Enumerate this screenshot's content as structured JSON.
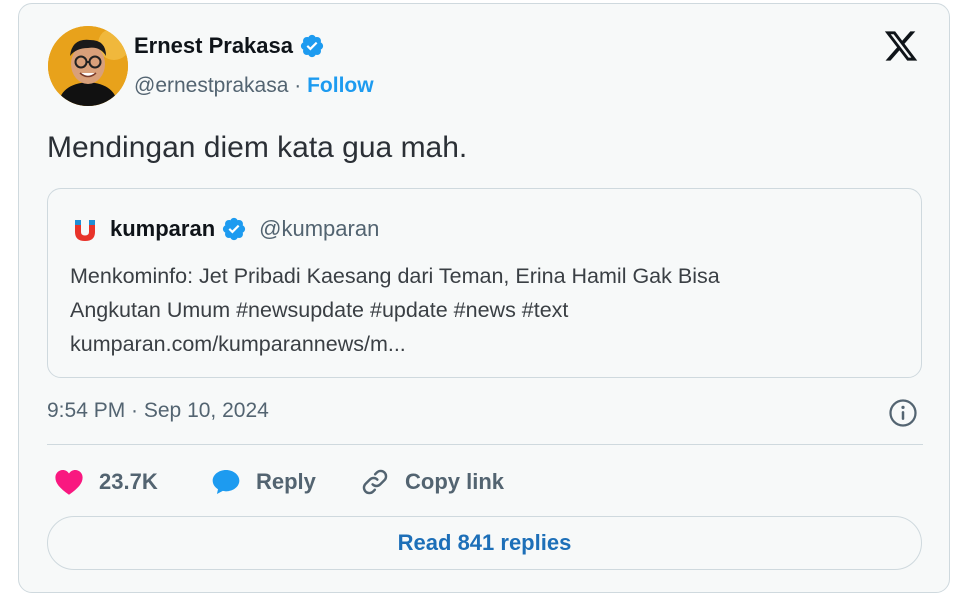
{
  "author": {
    "name": "Ernest Prakasa",
    "handle": "@ernestprakasa",
    "separator": "·",
    "follow_label": "Follow",
    "verified_icon": "verified-badge-icon",
    "avatar_icon": "avatar-photo"
  },
  "platform_icon": "x-logo-icon",
  "tweet": {
    "text": "Mendingan diem kata gua mah."
  },
  "quote": {
    "icon": "kumparan-logo-icon",
    "name": "kumparan",
    "handle": "@kumparan",
    "lines": [
      "Menkominfo: Jet Pribadi Kaesang dari Teman, Erina Hamil Gak Bisa",
      "Angkutan Umum #newsupdate #update #news #text",
      "kumparan.com/kumparannews/m..."
    ]
  },
  "timestamp": "9:54 PM · Sep 10, 2024",
  "info_icon": "info-icon",
  "actions": {
    "like_count": "23.7K",
    "reply_label": "Reply",
    "copy_label": "Copy link"
  },
  "read_replies_label": "Read 841 replies",
  "colors": {
    "accent": "#1d9bf0",
    "like": "#f91880",
    "border": "#cfd9de",
    "muted": "#536471"
  }
}
